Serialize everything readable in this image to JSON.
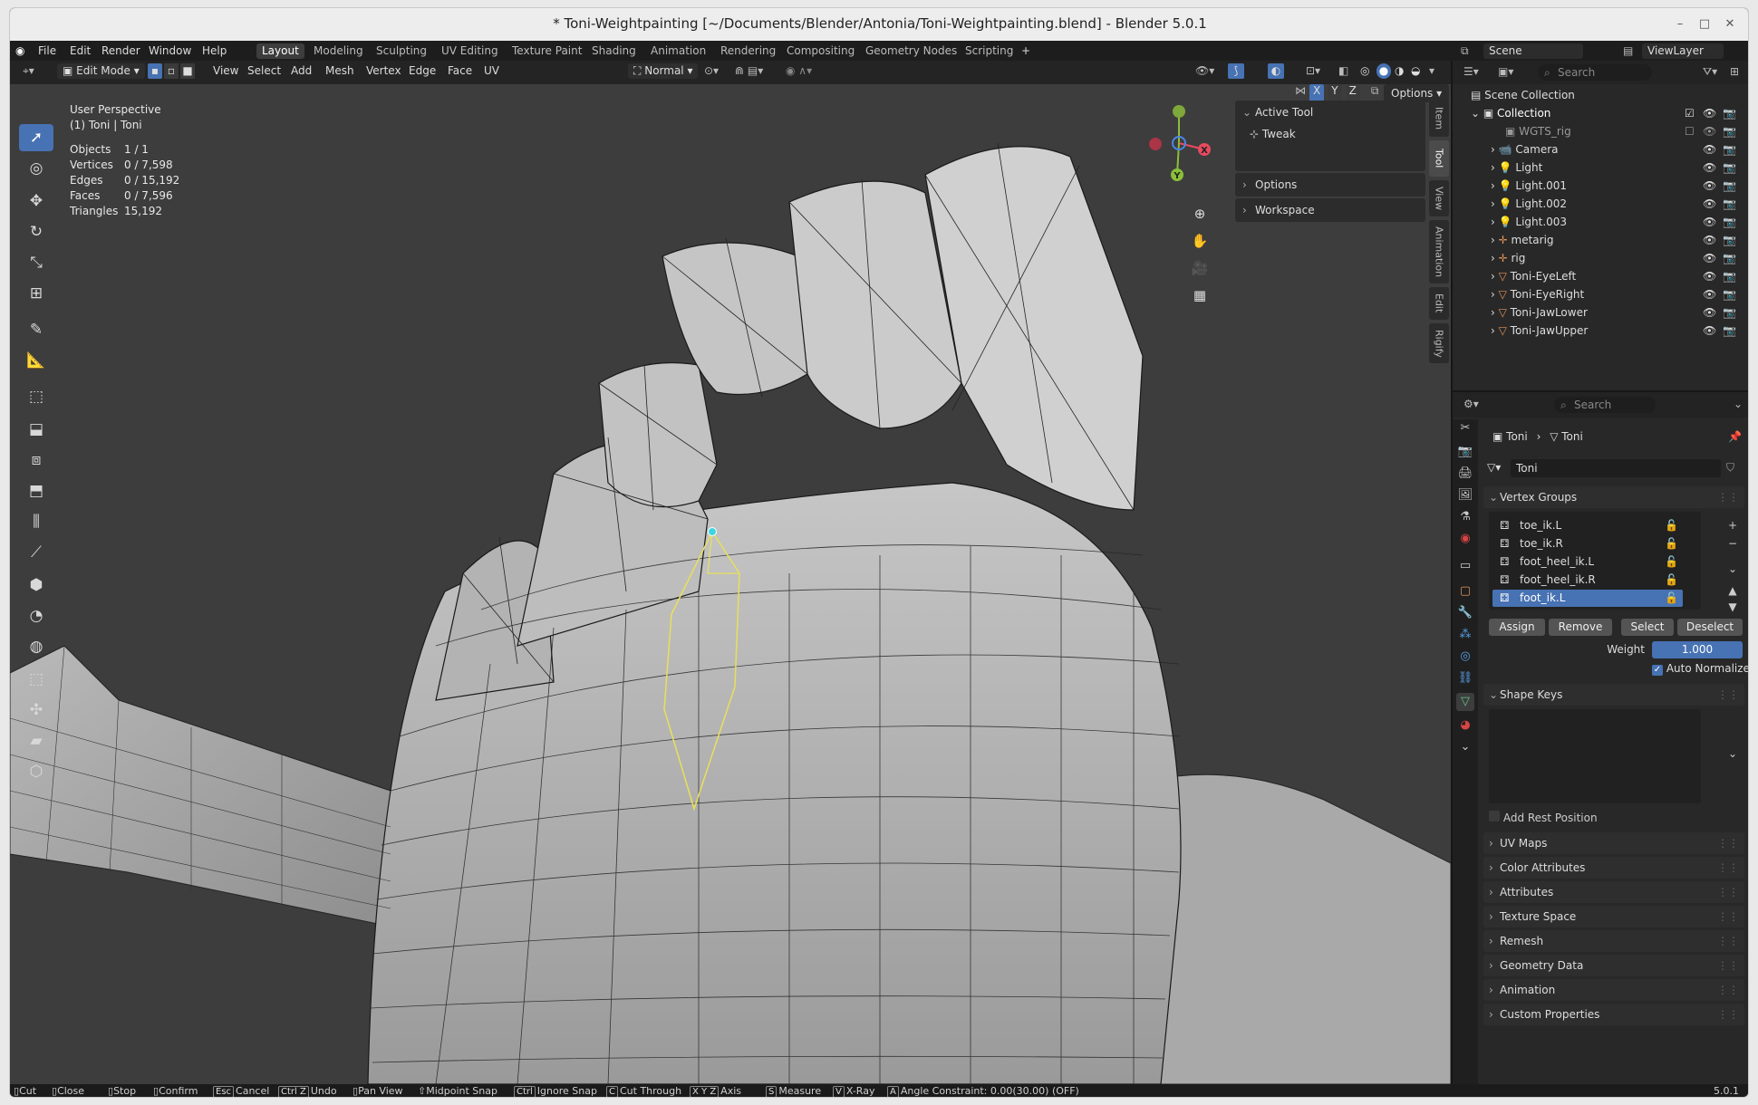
{
  "window": {
    "title": "* Toni-Weightpainting [~/Documents/Blender/Antonia/Toni-Weightpainting.blend] - Blender 5.0.1"
  },
  "menu": {
    "items": [
      "File",
      "Edit",
      "Render",
      "Window",
      "Help"
    ],
    "workspaces": [
      "Layout",
      "Modeling",
      "Sculpting",
      "UV Editing",
      "Texture Paint",
      "Shading",
      "Animation",
      "Rendering",
      "Compositing",
      "Geometry Nodes",
      "Scripting"
    ],
    "active_workspace": "Layout",
    "add_tab": "+",
    "scene_label": "Scene",
    "viewlayer_label": "ViewLayer"
  },
  "viewport_header": {
    "mode": "Edit Mode",
    "menus": [
      "View",
      "Select",
      "Add",
      "Mesh",
      "Vertex",
      "Edge",
      "Face",
      "UV"
    ],
    "orientation": "Normal",
    "axes": [
      "X",
      "Y",
      "Z"
    ],
    "options": "Options"
  },
  "overlay_text": {
    "perspective": "User Perspective",
    "object": "(1) Toni | Toni",
    "stats": [
      {
        "label": "Objects",
        "value": "1 / 1"
      },
      {
        "label": "Vertices",
        "value": "0 / 7,598"
      },
      {
        "label": "Edges",
        "value": "0 / 15,192"
      },
      {
        "label": "Faces",
        "value": "0 / 7,596"
      },
      {
        "label": "Triangles",
        "value": "15,192"
      }
    ]
  },
  "side_panel": {
    "active_tool_label": "Active Tool",
    "tool_name": "Tweak",
    "options_label": "Options",
    "workspace_label": "Workspace",
    "tabs": [
      "Item",
      "Tool",
      "View",
      "Animation",
      "Edit",
      "Rigify"
    ],
    "active_tab": "Tool"
  },
  "gizmo": {
    "x": "X",
    "y": "Y"
  },
  "outliner": {
    "search_placeholder": "Search",
    "root": "Scene Collection",
    "collection": "Collection",
    "items": [
      {
        "name": "WGTS_rig",
        "icon": "collection-icon"
      },
      {
        "name": "Camera",
        "icon": "camera-icon"
      },
      {
        "name": "Light",
        "icon": "light-icon"
      },
      {
        "name": "Light.001",
        "icon": "light-icon"
      },
      {
        "name": "Light.002",
        "icon": "light-icon"
      },
      {
        "name": "Light.003",
        "icon": "light-icon"
      },
      {
        "name": "metarig",
        "icon": "armature-icon"
      },
      {
        "name": "rig",
        "icon": "armature-icon"
      },
      {
        "name": "Toni-EyeLeft",
        "icon": "mesh-icon"
      },
      {
        "name": "Toni-EyeRight",
        "icon": "mesh-icon"
      },
      {
        "name": "Toni-JawLower",
        "icon": "mesh-icon"
      },
      {
        "name": "Toni-JawUpper",
        "icon": "mesh-icon"
      }
    ]
  },
  "properties": {
    "search_placeholder": "Search",
    "breadcrumb": [
      "Toni",
      "Toni"
    ],
    "data_name": "Toni",
    "vertex_groups_label": "Vertex Groups",
    "vertex_groups": [
      "toe_ik.L",
      "toe_ik.R",
      "foot_heel_ik.L",
      "foot_heel_ik.R",
      "foot_ik.L"
    ],
    "selected_group": "foot_ik.L",
    "buttons": {
      "assign": "Assign",
      "remove": "Remove",
      "select": "Select",
      "deselect": "Deselect"
    },
    "weight_label": "Weight",
    "weight_value": "1.000",
    "auto_normalize": "Auto Normalize",
    "shape_keys_label": "Shape Keys",
    "add_rest_position": "Add Rest Position",
    "sections": [
      "UV Maps",
      "Color Attributes",
      "Attributes",
      "Texture Space",
      "Remesh",
      "Geometry Data",
      "Animation",
      "Custom Properties"
    ]
  },
  "statusbar": {
    "items": [
      {
        "key": "",
        "text": "Cut"
      },
      {
        "key": "",
        "text": "Close"
      },
      {
        "key": "",
        "text": "Stop"
      },
      {
        "key": "",
        "text": "Confirm"
      },
      {
        "key": "Esc",
        "text": "Cancel"
      },
      {
        "key": "Ctrl Z",
        "text": "Undo"
      },
      {
        "key": "",
        "text": "Pan View"
      },
      {
        "key": "",
        "text": "Midpoint Snap"
      },
      {
        "key": "Ctrl",
        "text": "Ignore Snap"
      },
      {
        "key": "C",
        "text": "Cut Through"
      },
      {
        "key": "X Y Z",
        "text": "Axis"
      },
      {
        "key": "S",
        "text": "Measure"
      },
      {
        "key": "V",
        "text": "X-Ray"
      },
      {
        "key": "A",
        "text": "Angle Constraint: 0.00(30.00) (OFF)"
      }
    ],
    "version": "5.0.1"
  },
  "colors": {
    "accent": "#4772b3",
    "mesh": "#a8a8a8",
    "selection": "#e8e05a",
    "vertex_active": "#3fd4e0"
  }
}
